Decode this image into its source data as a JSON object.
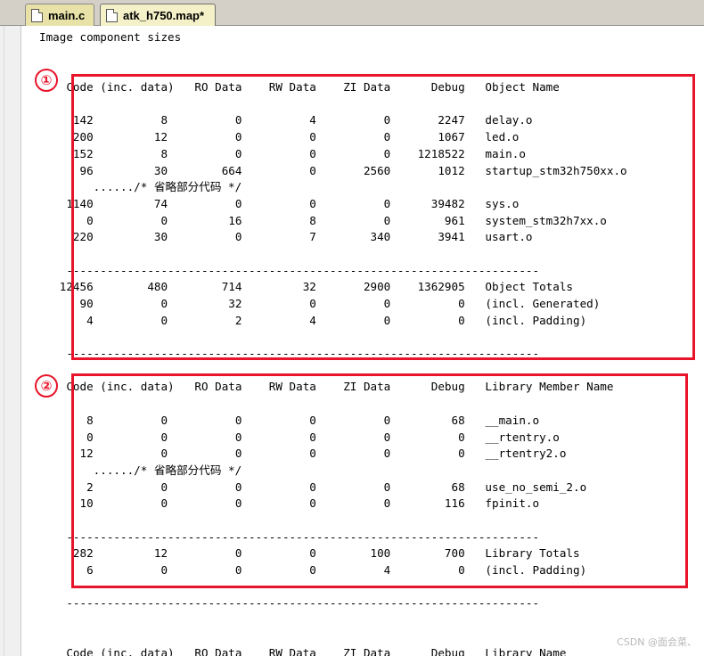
{
  "tabs": [
    {
      "label": "main.c",
      "active": false
    },
    {
      "label": "atk_h750.map*",
      "active": true
    }
  ],
  "lines": [
    "Image component sizes",
    "",
    "",
    "    Code (inc. data)   RO Data    RW Data    ZI Data      Debug   Object Name",
    "",
    "     142          8          0          4          0       2247   delay.o",
    "     200         12          0          0          0       1067   led.o",
    "     152          8          0          0          0    1218522   main.o",
    "      96         30        664          0       2560       1012   startup_stm32h750xx.o",
    "        ....../* 省略部分代码 */",
    "    1140         74          0          0          0      39482   sys.o",
    "       0          0         16          8          0        961   system_stm32h7xx.o",
    "     220         30          0          7        340       3941   usart.o",
    "",
    "    ----------------------------------------------------------------------",
    "   12456        480        714         32       2900    1362905   Object Totals",
    "      90          0         32          0          0          0   (incl. Generated)",
    "       4          0          2          4          0          0   (incl. Padding)",
    "",
    "    ----------------------------------------------------------------------",
    "",
    "    Code (inc. data)   RO Data    RW Data    ZI Data      Debug   Library Member Name",
    "",
    "       8          0          0          0          0         68   __main.o",
    "       0          0          0          0          0          0   __rtentry.o",
    "      12          0          0          0          0          0   __rtentry2.o",
    "        ....../* 省略部分代码 */",
    "       2          0          0          0          0         68   use_no_semi_2.o",
    "      10          0          0          0          0        116   fpinit.o",
    "",
    "    ----------------------------------------------------------------------",
    "     282         12          0          0        100        700   Library Totals",
    "       6          0          0          0          4          0   (incl. Padding)",
    "",
    "    ----------------------------------------------------------------------",
    "",
    "",
    "    Code (inc. data)   RO Data    RW Data    ZI Data      Debug   Library Name"
  ],
  "markers": [
    "①",
    "②"
  ],
  "watermark": "CSDN @面会菜、",
  "colors": {
    "highlight": "#e8142a",
    "tab_active": "#f4f1c8",
    "tab_inactive": "#e8e2a8"
  }
}
